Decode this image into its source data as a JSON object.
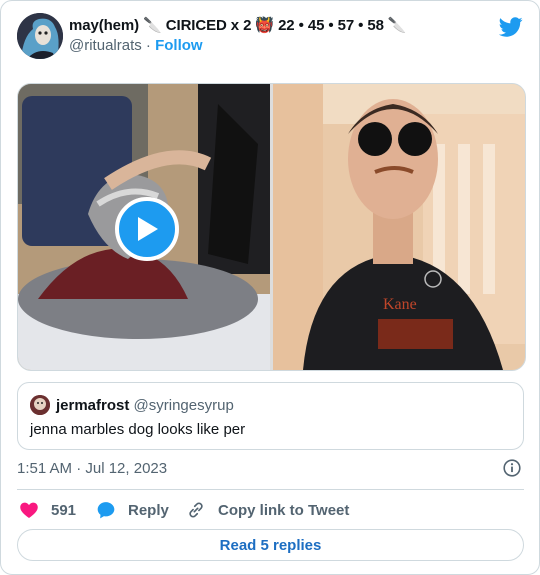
{
  "tweet": {
    "author": {
      "name": "may(hem) 🔪 CIRICED x 2 👹 22 • 45 • 57 • 58 🔪",
      "handle": "@ritualrats",
      "separator": "·",
      "follow_label": "Follow"
    },
    "media": {
      "left": {
        "type": "video"
      },
      "right": {
        "type": "image"
      }
    },
    "quoted_tweet": {
      "name": "jermafrost",
      "handle": "@syringesyrup",
      "text": "jenna marbles dog looks like per"
    },
    "timestamp": "1:51 AM · Jul 12, 2023",
    "actions": {
      "like_count": "591",
      "reply_label": "Reply",
      "copy_label": "Copy link to Tweet"
    },
    "read_replies_label": "Read 5 replies"
  },
  "colors": {
    "accent": "#1d9bf0",
    "like": "#f91880",
    "border": "#cfd9de",
    "secondary_text": "#536471",
    "replies_link": "#1d6ec2"
  },
  "icons": [
    "twitter-bird-icon",
    "play-icon",
    "info-icon",
    "heart-icon",
    "reply-bubble-icon",
    "link-icon"
  ]
}
